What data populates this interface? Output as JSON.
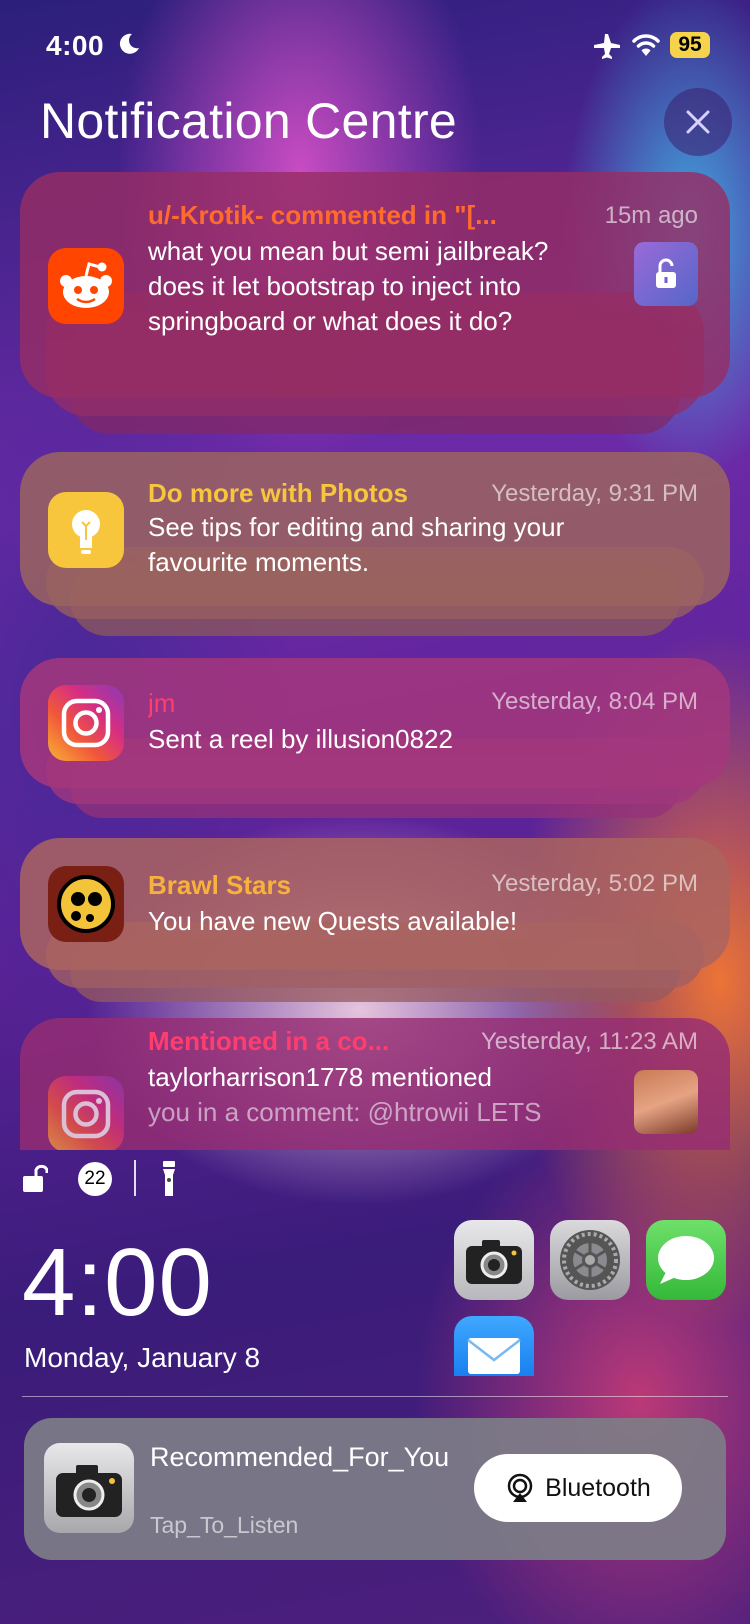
{
  "status_bar": {
    "time": "4:00",
    "battery": "95",
    "icons": [
      "moon-icon",
      "airplane-icon",
      "wifi-icon"
    ]
  },
  "header": {
    "title": "Notification Centre",
    "close_icon": "close-icon"
  },
  "notifications": [
    {
      "app": "Reddit",
      "icon": "reddit-icon",
      "title": "u/-Krotik- commented in \"[...",
      "time": "15m ago",
      "body": "what you mean but semi jailbreak? does it let bootstrap to inject into springboard or what does it do?",
      "thumbnail": "unlock-thumbnail",
      "title_color": "#ff6b2d"
    },
    {
      "app": "Tips",
      "icon": "lightbulb-icon",
      "title": "Do more with Photos",
      "time": "Yesterday, 9:31 PM",
      "body": "See tips for editing and sharing your favourite moments.",
      "title_color": "#f8c63c"
    },
    {
      "app": "Instagram",
      "icon": "instagram-icon",
      "title": "jm",
      "time": "Yesterday, 8:04 PM",
      "body": "Sent a reel by illusion0822",
      "title_color": "#ff3d6e"
    },
    {
      "app": "Brawl Stars",
      "icon": "brawl-stars-icon",
      "title": "Brawl Stars",
      "time": "Yesterday, 5:02 PM",
      "body": "You have new Quests available!",
      "title_color": "#f8b23c"
    },
    {
      "app": "Instagram",
      "icon": "instagram-icon",
      "title": "Mentioned in a co...",
      "time": "Yesterday, 11:23 AM",
      "body_line1": "taylorharrison1778 mentioned",
      "body_line2": "you in a comment: @htrowii LETS",
      "thumbnail": "photo-thumbnail",
      "title_color": "#ff3d6e"
    }
  ],
  "lock_screen": {
    "notification_count": "22",
    "clock": "4:00",
    "date": "Monday, January 8",
    "apps": [
      "camera-icon",
      "settings-icon",
      "messages-icon",
      "mail-icon"
    ]
  },
  "media": {
    "title": "Recommended_For_You",
    "subtitle": "Tap_To_Listen",
    "output_label": "Bluetooth"
  }
}
